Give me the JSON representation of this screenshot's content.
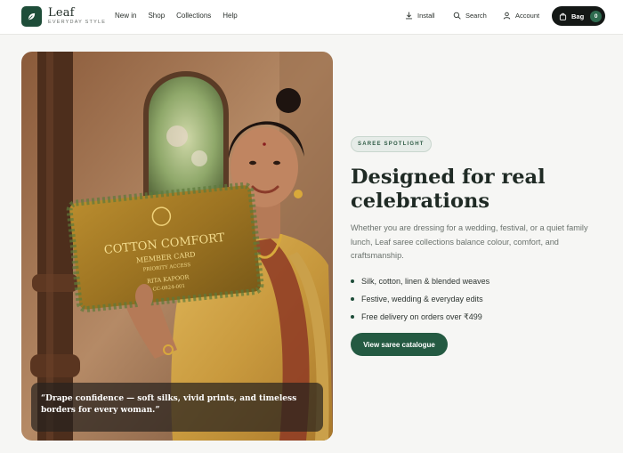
{
  "brand": {
    "name": "Leaf",
    "tagline": "EVERYDAY STYLE",
    "logo_icon": "leaf-icon"
  },
  "nav": [
    {
      "label": "New in"
    },
    {
      "label": "Shop"
    },
    {
      "label": "Collections"
    },
    {
      "label": "Help"
    }
  ],
  "header_actions": {
    "install": {
      "label": "Install",
      "icon": "download-icon"
    },
    "search": {
      "label": "Search",
      "icon": "search-icon"
    },
    "account": {
      "label": "Account",
      "icon": "user-icon"
    },
    "bag": {
      "label": "Bag",
      "count": "0",
      "icon": "bag-icon"
    }
  },
  "hero": {
    "image_alt": "Woman in a saree holding a Cotton Comfort member card",
    "card": {
      "brand": "COTTON COMFORT",
      "title": "MEMBER CARD",
      "subtitle": "PRIORITY ACCESS",
      "holder": "RITA KAPOOR",
      "number": "CC-0824-001"
    },
    "quote": "“Drape confidence — soft silks, vivid prints, and timeless borders for every woman.”"
  },
  "content": {
    "eyebrow": "SAREE SPOTLIGHT",
    "headline": "Designed for real celebrations",
    "description": "Whether you are dressing for a wedding, festival, or a quiet family lunch, Leaf saree collections balance colour, comfort, and craftsmanship.",
    "bullets": [
      "Silk, cotton, linen & blended weaves",
      "Festive, wedding & everyday edits",
      "Free delivery on orders over ₹499"
    ],
    "cta": "View saree catalogue"
  },
  "colors": {
    "brand_green": "#1e4d39",
    "cta_green": "#245a42",
    "bag_black": "#141816"
  }
}
